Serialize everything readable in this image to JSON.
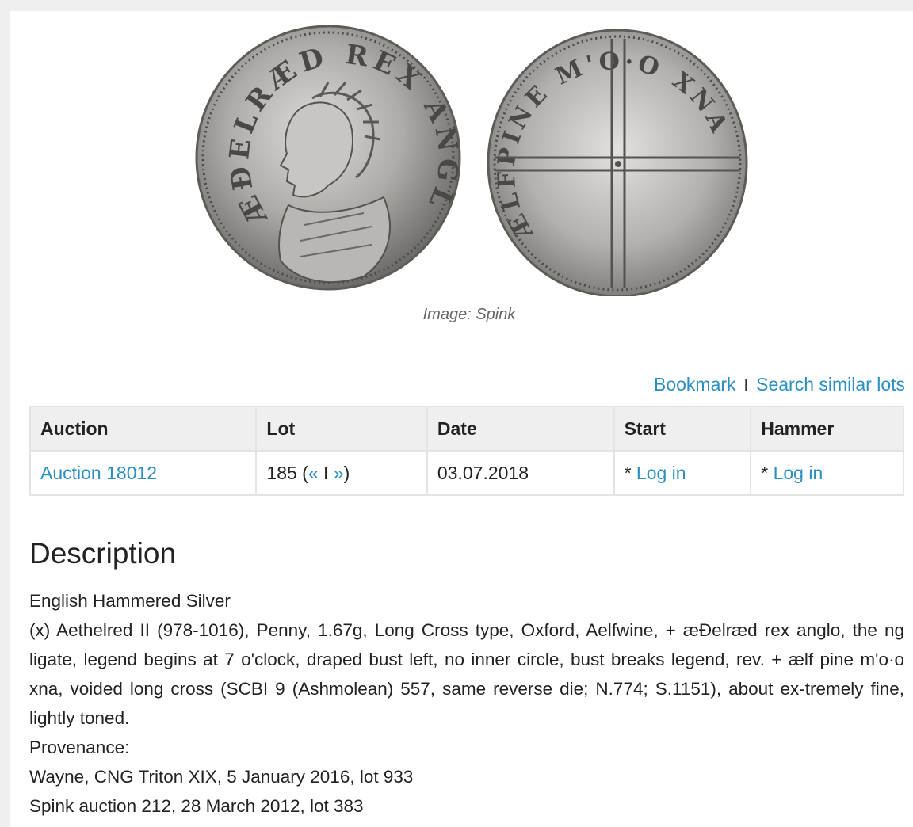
{
  "image": {
    "caption": "Image: Spink",
    "obverse_legend": "ÆÐELRÆD REX ANGLO",
    "reverse_legend": "ÆLFPINE M'O·O XNA"
  },
  "actions": {
    "bookmark": "Bookmark",
    "separator": "I",
    "search_similar": "Search similar lots"
  },
  "table": {
    "headers": [
      "Auction",
      "Lot",
      "Date",
      "Start",
      "Hammer"
    ],
    "row": {
      "auction": "Auction 18012",
      "lot_number": "185",
      "lot_prev": "«",
      "lot_sep": "I",
      "lot_next": "»",
      "date": "03.07.2018",
      "start_prefix": "*",
      "start_link": "Log in",
      "hammer_prefix": "*",
      "hammer_link": "Log in"
    }
  },
  "description": {
    "title": "Description",
    "lines": [
      "English Hammered Silver",
      "(x) Aethelred II (978-1016), Penny, 1.67g, Long Cross type, Oxford, Aelfwine, + æÐelræd rex anglo, the ng ligate, legend begins at 7 o'clock, draped bust left, no inner circle, bust breaks legend, rev. + ælf pine m'o·o xna, voided long cross (SCBI 9 (Ashmolean) 557, same reverse die; N.774; S.1151), about ex-tremely fine, lightly toned.",
      "Provenance:",
      "Wayne, CNG Triton XIX, 5 January 2016, lot 933",
      "Spink auction 212, 28 March 2012, lot 383"
    ]
  },
  "colors": {
    "link": "#2a8fc1",
    "header_bg": "#efefef",
    "border": "#e4e4e4",
    "coin_silver": "#a9a7a3"
  }
}
